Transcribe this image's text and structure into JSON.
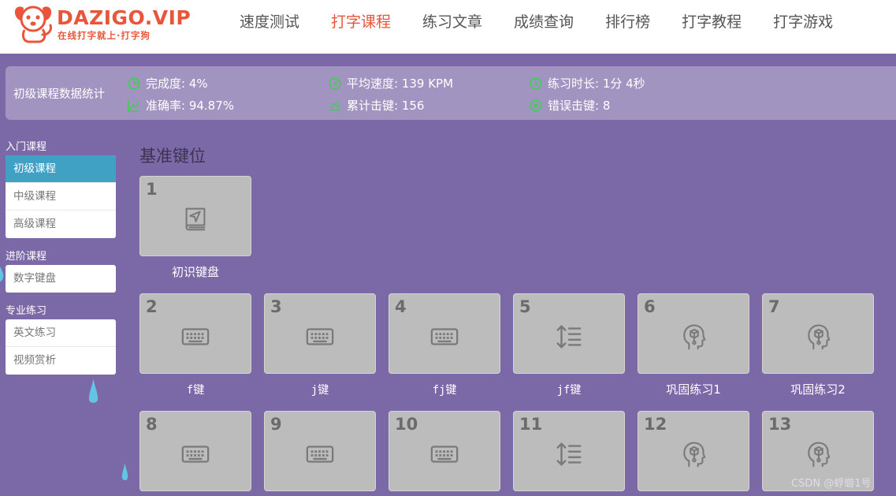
{
  "header": {
    "logo_title": "DAZIGO.VIP",
    "logo_subtitle": "在线打字就上·打字狗",
    "brand_color": "#e8553a",
    "nav": [
      {
        "label": "速度测试",
        "active": false
      },
      {
        "label": "打字课程",
        "active": true
      },
      {
        "label": "练习文章",
        "active": false
      },
      {
        "label": "成绩查询",
        "active": false
      },
      {
        "label": "排行榜",
        "active": false
      },
      {
        "label": "打字教程",
        "active": false
      },
      {
        "label": "打字游戏",
        "active": false
      }
    ]
  },
  "stats": {
    "title": "初级课程数据统计",
    "completion": "完成度: 4%",
    "accuracy": "准确率: 94.87%",
    "avg_speed": "平均速度: 139 KPM",
    "total_keys": "累计击键: 156",
    "duration": "练习时长: 1分 4秒",
    "error_keys": "错误击键: 8",
    "icon_color": "#3ccf52"
  },
  "sidebar": {
    "groups": [
      {
        "title": "入门课程",
        "items": [
          {
            "label": "初级课程",
            "active": true
          },
          {
            "label": "中级课程",
            "active": false
          },
          {
            "label": "高级课程",
            "active": false
          }
        ]
      },
      {
        "title": "进阶课程",
        "items": [
          {
            "label": "数字键盘",
            "active": false
          }
        ]
      },
      {
        "title": "专业练习",
        "items": [
          {
            "label": "英文练习",
            "active": false
          },
          {
            "label": "视频赏析",
            "active": false
          }
        ]
      }
    ],
    "active_color": "#41a1c5"
  },
  "main": {
    "section_title": "基准键位",
    "lessons": [
      {
        "num": "1",
        "label": "初识键盘",
        "icon": "book-navigation-icon"
      },
      {
        "num": "2",
        "label": "f键",
        "icon": "keyboard-icon"
      },
      {
        "num": "3",
        "label": "j键",
        "icon": "keyboard-icon"
      },
      {
        "num": "4",
        "label": "fj键",
        "icon": "keyboard-icon"
      },
      {
        "num": "5",
        "label": "jf键",
        "icon": "line-height-icon"
      },
      {
        "num": "6",
        "label": "巩固练习1",
        "icon": "head-cube-icon"
      },
      {
        "num": "7",
        "label": "巩固练习2",
        "icon": "head-cube-icon"
      },
      {
        "num": "8",
        "label": "",
        "icon": "keyboard-icon"
      },
      {
        "num": "9",
        "label": "",
        "icon": "keyboard-icon"
      },
      {
        "num": "10",
        "label": "",
        "icon": "keyboard-icon"
      },
      {
        "num": "11",
        "label": "",
        "icon": "line-height-icon"
      },
      {
        "num": "12",
        "label": "",
        "icon": "head-cube-icon"
      },
      {
        "num": "13",
        "label": "",
        "icon": "head-cube-icon"
      }
    ]
  },
  "watermark": "CSDN @蜉蝣1号"
}
